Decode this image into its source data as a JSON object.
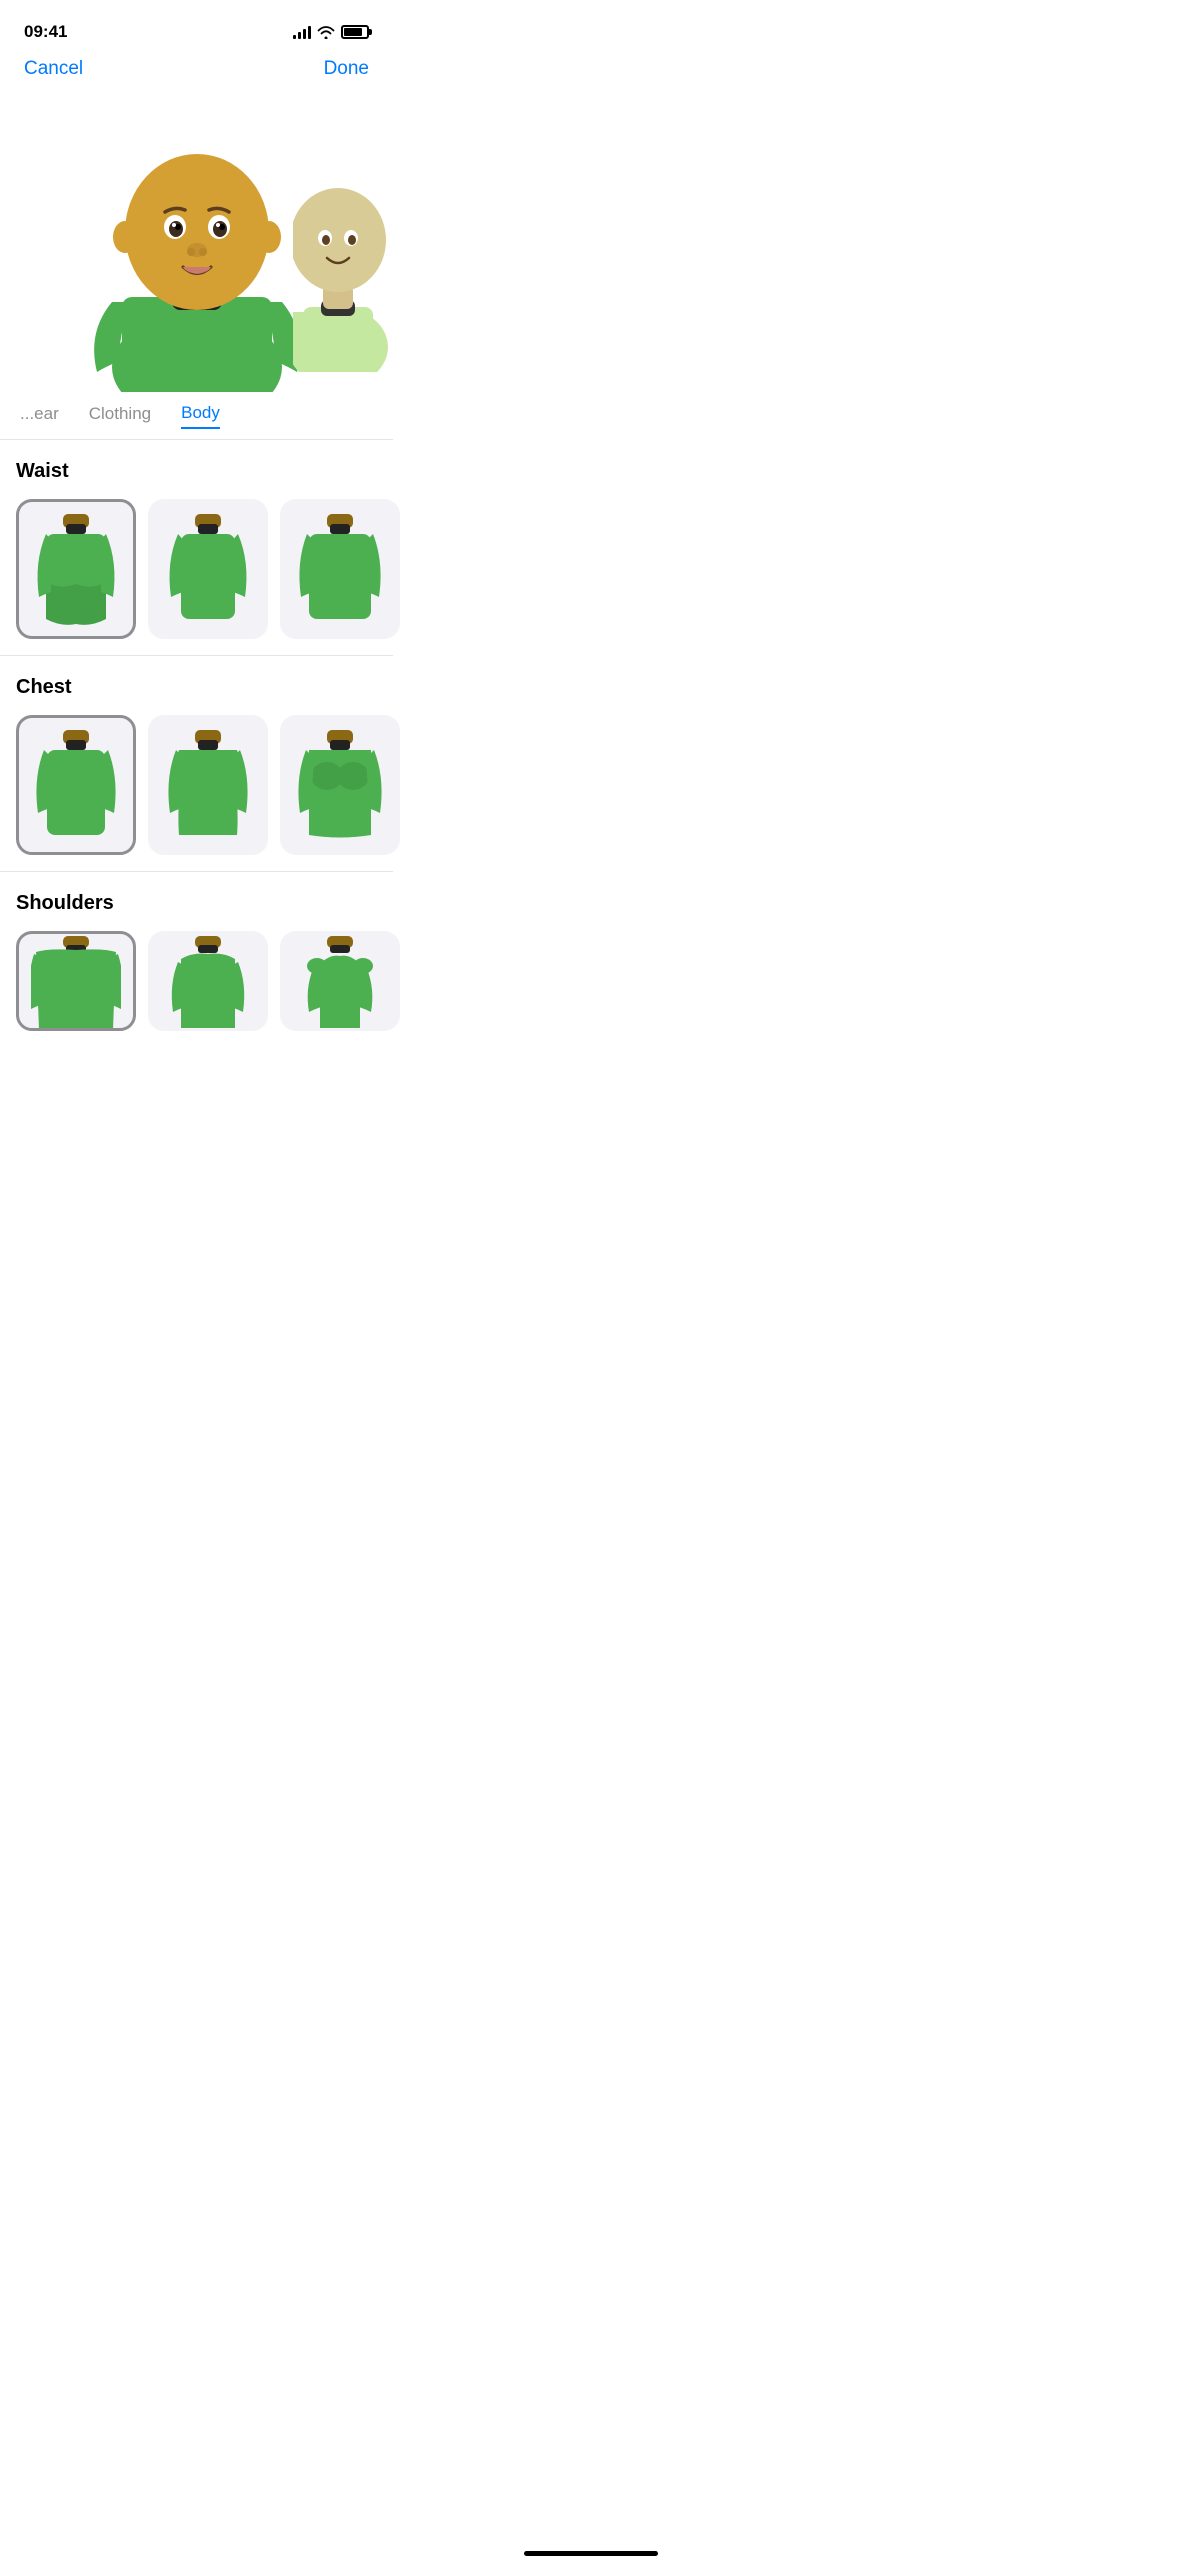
{
  "statusBar": {
    "time": "09:41"
  },
  "navBar": {
    "cancelLabel": "Cancel",
    "doneLabel": "Done"
  },
  "tabs": [
    {
      "id": "headwear",
      "label": "...ear",
      "active": false,
      "partial": true
    },
    {
      "id": "clothing",
      "label": "Clothing",
      "active": false
    },
    {
      "id": "body",
      "label": "Body",
      "active": true
    }
  ],
  "sections": [
    {
      "id": "waist",
      "title": "Waist",
      "options": [
        {
          "id": "waist-1",
          "selected": true
        },
        {
          "id": "waist-2",
          "selected": false
        },
        {
          "id": "waist-3",
          "selected": false
        }
      ]
    },
    {
      "id": "chest",
      "title": "Chest",
      "options": [
        {
          "id": "chest-1",
          "selected": true
        },
        {
          "id": "chest-2",
          "selected": false
        },
        {
          "id": "chest-3",
          "selected": false
        }
      ]
    },
    {
      "id": "shoulders",
      "title": "Shoulders",
      "options": [
        {
          "id": "shoulders-1",
          "selected": true
        },
        {
          "id": "shoulders-2",
          "selected": false
        },
        {
          "id": "shoulders-3",
          "selected": false
        }
      ]
    }
  ],
  "homeIndicator": true
}
